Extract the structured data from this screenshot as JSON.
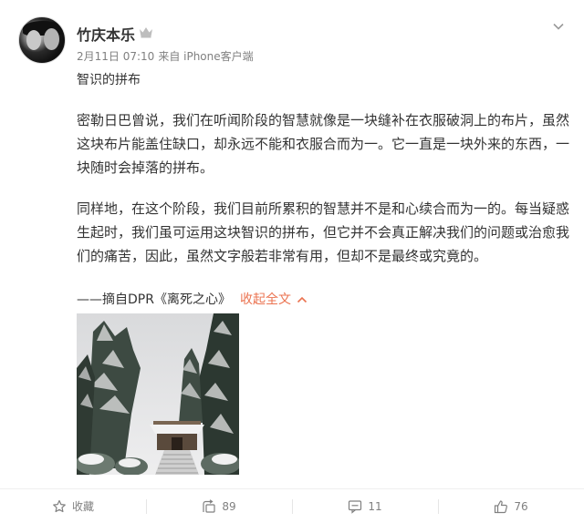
{
  "user": {
    "name": "竹庆本乐"
  },
  "meta": {
    "date": "2月11日 07:10",
    "from": "来自 iPhone客户端"
  },
  "post": {
    "title": "智识的拼布",
    "paragraphs": [
      "密勒日巴曾说，我们在听闻阶段的智慧就像是一块缝补在衣服破洞上的布片，虽然这块布片能盖住缺口，却永远不能和衣服合而为一。它一直是一块外来的东西，一块随时会掉落的拼布。",
      "同样地，在这个阶段，我们目前所累积的智慧并不是和心续合而为一的。每当疑惑生起时，我们虽可运用这块智识的拼布，但它并不会真正解决我们的问题或治愈我们的痛苦，因此，虽然文字般若非常有用，但却不是最终或究竟的。"
    ],
    "source": "——摘自DPR《离死之心》",
    "collapse_label": "收起全文"
  },
  "actions": {
    "favorite_label": "收藏",
    "repost_count": "89",
    "comment_count": "11",
    "like_count": "76"
  },
  "colors": {
    "accent": "#eb7350",
    "meta_gray": "#808080"
  },
  "icons": {
    "verified": "crown-icon",
    "menu": "chevron-down-icon",
    "favorite": "star-icon",
    "repost": "repost-icon",
    "comment": "comment-icon",
    "like": "thumbs-up-icon"
  }
}
